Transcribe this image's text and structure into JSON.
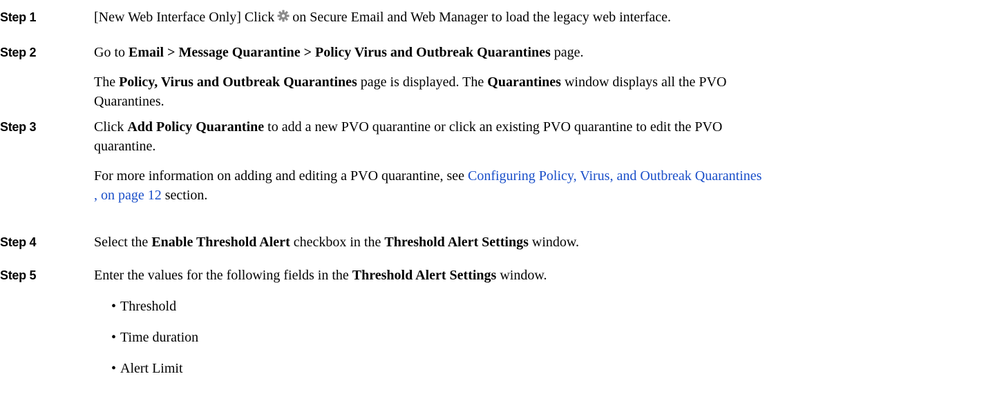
{
  "step1": {
    "label": "Step 1",
    "prefix": "[New Web Interface Only] Click",
    "gear_icon": "gear-icon",
    "suffix": "on Secure Email and Web Manager to load the legacy web interface."
  },
  "step2": {
    "label": "Step 2",
    "p1_go": "Go to",
    "p1_path": "Email > Message Quarantine > Policy Virus and Outbreak Quarantines",
    "p1_end": "page.",
    "p2_the": "The",
    "p2_page": "Policy, Virus and Outbreak Quarantines",
    "p2_mid": "page is displayed. The",
    "p2_window": "Quarantines",
    "p2_end_line1": "window displays all the PVO",
    "p2_end_line2": "Quarantines."
  },
  "step3": {
    "label": "Step 3",
    "p1_click": "Click",
    "p1_button": "Add Policy Quarantine",
    "p1_rest_line1": "to add a new PVO quarantine or click an existing PVO quarantine to edit the PVO",
    "p1_rest_line2": "quarantine.",
    "p2_start": "For more information on adding and editing a PVO quarantine, see",
    "p2_link_line1": "Configuring Policy, Virus, and Outbreak Quarantines",
    "p2_link_line2": ", on page 12",
    "p2_end": "section."
  },
  "step4": {
    "label": "Step 4",
    "select": "Select the",
    "checkbox": "Enable Threshold Alert",
    "mid": "checkbox in the",
    "window": "Threshold Alert Settings",
    "end": "window."
  },
  "step5": {
    "label": "Step 5",
    "start": "Enter the values for the following fields in the",
    "window": "Threshold Alert Settings",
    "end": "window.",
    "bullet": "•",
    "fields": [
      "Threshold",
      "Time duration",
      "Alert Limit"
    ]
  }
}
